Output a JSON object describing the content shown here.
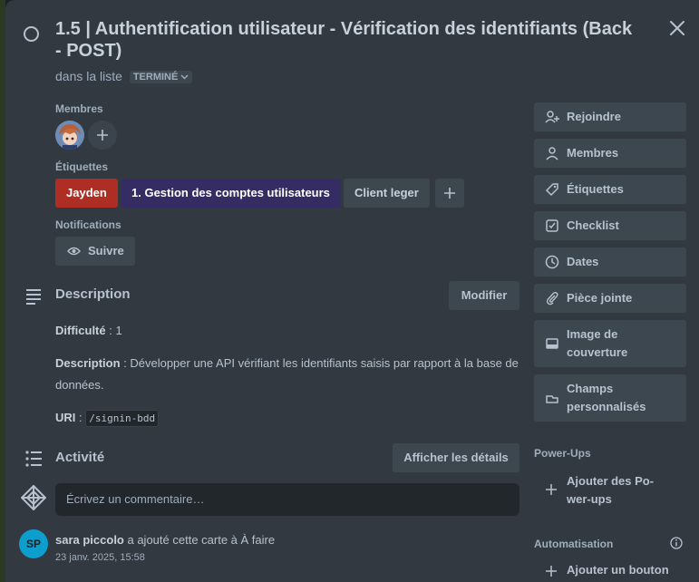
{
  "card": {
    "title": "1.5 | Authentification utilisateur - Vérification des identifiants (Back - POST)",
    "list_prefix": "dans la liste",
    "list_name": "TERMINÉ"
  },
  "members": {
    "heading": "Membres"
  },
  "labels": {
    "heading": "Étiquettes",
    "items": [
      {
        "text": "Jayden",
        "color": "#ae2e24"
      },
      {
        "text": "1. Gestion des comptes utilisateurs",
        "color": "#352c63"
      },
      {
        "text": "Client leger",
        "color": "#3d474f"
      }
    ]
  },
  "notifications": {
    "heading": "Notifications",
    "watch_label": "Suivre"
  },
  "description": {
    "heading": "Description",
    "edit_label": "Modifier",
    "difficulty_label": "Difficulté",
    "difficulty_value": " : 1",
    "desc_label": "Description",
    "desc_value": " : Développer une API vérifiant les identifiants saisis par rapport à la base de données.",
    "uri_label": "URI",
    "uri_sep": " : ",
    "uri_value": "/signin-bdd"
  },
  "activity": {
    "heading": "Activité",
    "details_label": "Afficher les détails",
    "comment_placeholder": "Écrivez un commentaire…",
    "entries": [
      {
        "initials": "SP",
        "user": "sara piccolo",
        "action": " a ajouté cette carte à À faire",
        "time": "23 janv. 2025, 15:58"
      }
    ]
  },
  "sidebar": {
    "buttons": [
      {
        "label": "Rejoindre",
        "icon": "add-person-icon"
      },
      {
        "label": "Membres",
        "icon": "person-icon"
      },
      {
        "label": "Étiquettes",
        "icon": "tag-icon"
      },
      {
        "label": "Checklist",
        "icon": "checkbox-icon"
      },
      {
        "label": "Dates",
        "icon": "clock-icon"
      },
      {
        "label": "Pièce jointe",
        "icon": "paperclip-icon"
      },
      {
        "label_line1": "Image de",
        "label_line2": "couverture",
        "icon": "cover-icon"
      },
      {
        "label_line1": "Champs",
        "label_line2": "personnalisés",
        "icon": "custom-fields-icon"
      }
    ],
    "powerups_heading": "Power-Ups",
    "powerups_add_line1": "Ajouter des Po-",
    "powerups_add_line2": "wer-ups",
    "automation_heading": "Automatisation",
    "automation_add": "Ajouter un bouton"
  },
  "colors": {
    "modal_bg": "#323940",
    "button_bg": "#3d474f",
    "text": "#b6c2cf",
    "avatar_sp": "#0c9ecc"
  }
}
